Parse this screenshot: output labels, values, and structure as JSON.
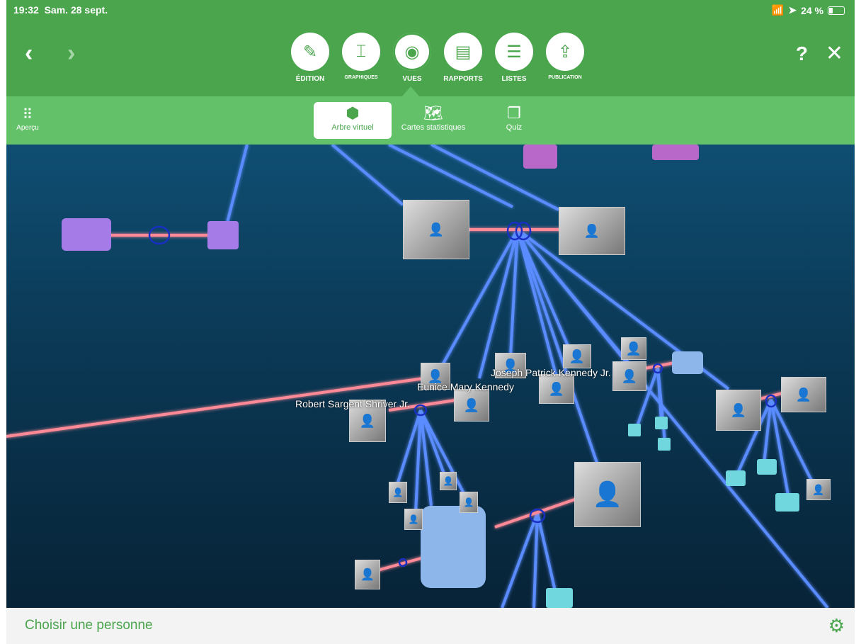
{
  "status": {
    "time": "19:32",
    "date": "Sam. 28 sept.",
    "battery": "24 %"
  },
  "toolbar": {
    "back_label": "‹",
    "forward_label": "›",
    "help_label": "?",
    "close_label": "✕",
    "tabs": [
      {
        "label": "ÉDITION",
        "icon": "pencil-icon"
      },
      {
        "label": "GRAPHIQUES",
        "icon": "chart-icon"
      },
      {
        "label": "VUES",
        "icon": "eye-icon"
      },
      {
        "label": "RAPPORTS",
        "icon": "report-icon"
      },
      {
        "label": "LISTES",
        "icon": "list-icon"
      },
      {
        "label": "PUBLICATION",
        "icon": "upload-icon"
      }
    ]
  },
  "subbar": {
    "apercu_label": "Aperçu",
    "tabs": [
      {
        "label": "Arbre virtuel",
        "icon": "cube-icon"
      },
      {
        "label": "Cartes statistiques",
        "icon": "map-icon"
      },
      {
        "label": "Quiz",
        "icon": "quiz-icon"
      }
    ]
  },
  "scene": {
    "labels": [
      "Joseph Patrick Kennedy Jr.",
      "Eunice Mary Kennedy",
      "Robert Sargent Shriver Jr."
    ]
  },
  "bottom": {
    "choose_label": "Choisir une personne"
  },
  "colors": {
    "accent": "#4aa54d",
    "subbar": "#63c16a",
    "link_blue": "#3f7bff",
    "link_red": "#ff6b7a"
  }
}
